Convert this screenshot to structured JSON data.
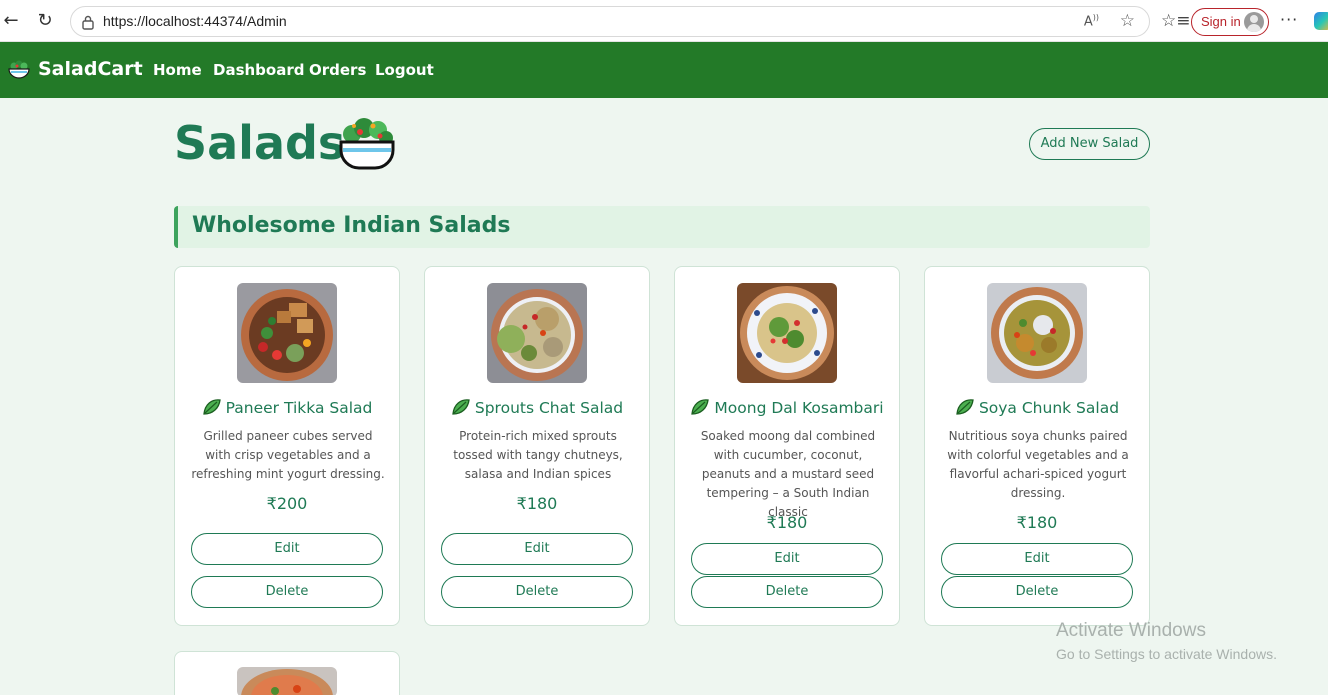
{
  "browser": {
    "url": "https://localhost:44374/Admin",
    "read_aloud_label": "A̅",
    "sign_in_label": "Sign in",
    "more_label": "···"
  },
  "navbar": {
    "brand": "SaladCart",
    "links": [
      "Home",
      "Dashboard",
      "Orders",
      "Logout"
    ]
  },
  "main": {
    "title": "Salads",
    "add_button": "Add New Salad",
    "section_title": "Wholesome Indian Salads",
    "cards": [
      {
        "name": "Paneer Tikka Salad",
        "description": "Grilled paneer cubes served with crisp vegetables and a refreshing mint yogurt dressing.",
        "price": "₹200",
        "edit_label": "Edit",
        "delete_label": "Delete"
      },
      {
        "name": "Sprouts Chat Salad",
        "description": "Protein-rich mixed sprouts tossed with tangy chutneys, salasa and Indian spices",
        "price": "₹180",
        "edit_label": "Edit",
        "delete_label": "Delete"
      },
      {
        "name": "Moong Dal Kosambari",
        "description": "Soaked moong dal combined with cucumber, coconut, peanuts and a mustard seed tempering – a South Indian classic",
        "price": "₹180",
        "edit_label": "Edit",
        "delete_label": "Delete"
      },
      {
        "name": "Soya Chunk Salad",
        "description": "Nutritious soya chunks paired with colorful vegetables and a flavorful achari-spiced yogurt dressing.",
        "price": "₹180",
        "edit_label": "Edit",
        "delete_label": "Delete"
      }
    ]
  },
  "watermark": {
    "line1": "Activate Windows",
    "line2": "Go to Settings to activate Windows."
  },
  "colors": {
    "navbar": "#237a28",
    "accent": "#1f7a55",
    "background": "#eef6f0"
  }
}
